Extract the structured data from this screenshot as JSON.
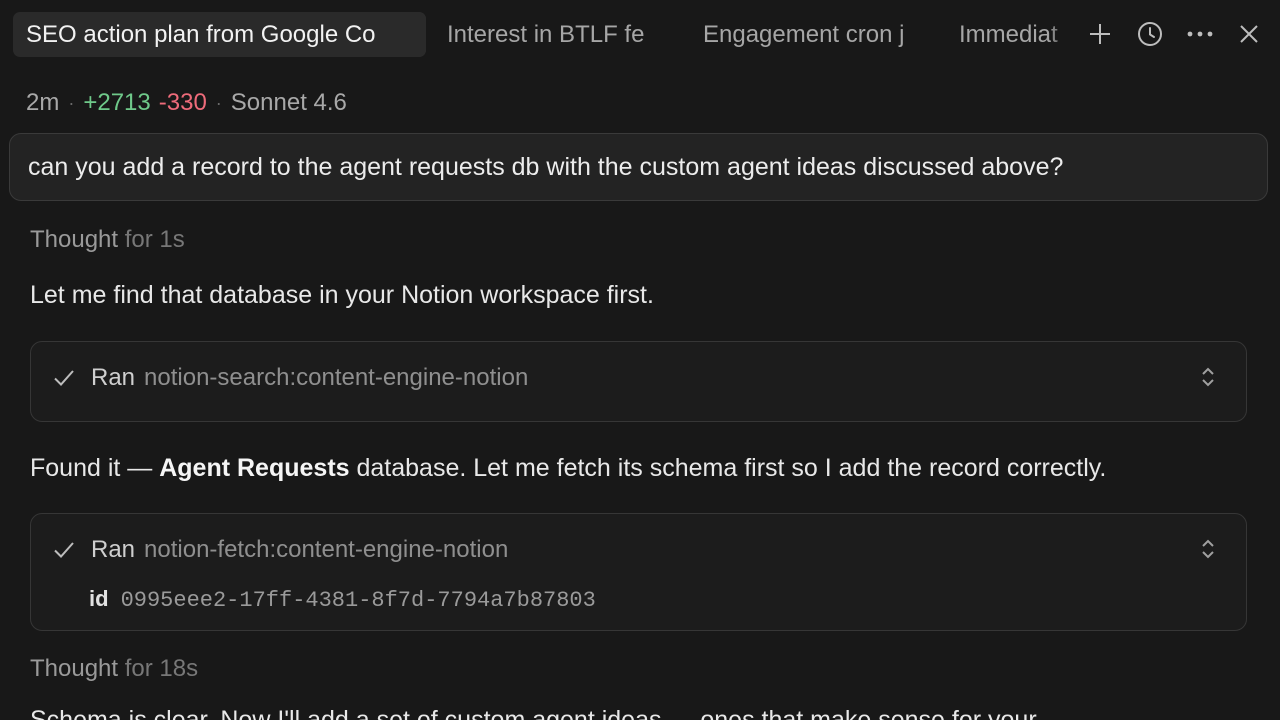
{
  "tabs": [
    {
      "label": "SEO action plan from Google Co",
      "active": true
    },
    {
      "label": "Interest in BTLF fe",
      "active": false
    },
    {
      "label": "Engagement cron j",
      "active": false
    },
    {
      "label": "Immediat",
      "active": false
    }
  ],
  "toolbar_icons": [
    "plus-icon",
    "history-clock-icon",
    "more-horizontal-icon",
    "close-icon"
  ],
  "meta": {
    "elapsed": "2m",
    "lines_added": "+2713",
    "lines_removed": "-330",
    "model": "Sonnet 4.6"
  },
  "user_message": "can you add a record to the agent requests db with the custom agent ideas discussed above?",
  "thought1": {
    "label": "Thought",
    "duration": "for 1s"
  },
  "para1": "Let me find that database in your Notion workspace first.",
  "tool1": {
    "ran": "Ran",
    "name": "notion-search:content-engine-notion"
  },
  "para2": {
    "before": "Found it — ",
    "bold": "Agent Requests",
    "after": " database. Let me fetch its schema first so I add the record correctly."
  },
  "tool2": {
    "ran": "Ran",
    "name": "notion-fetch:content-engine-notion",
    "param_key": "id",
    "param_value": "0995eee2-17ff-4381-8f7d-7794a7b87803"
  },
  "thought2": {
    "label": "Thought",
    "duration": "for 18s"
  },
  "para3": "Schema is clear. Now I'll add a set of custom agent ideas — ones that make sense for your",
  "colors": {
    "background": "#181818",
    "added": "#6fc98a",
    "removed": "#ee6b7a",
    "active_tab": "#2a2a2a"
  }
}
